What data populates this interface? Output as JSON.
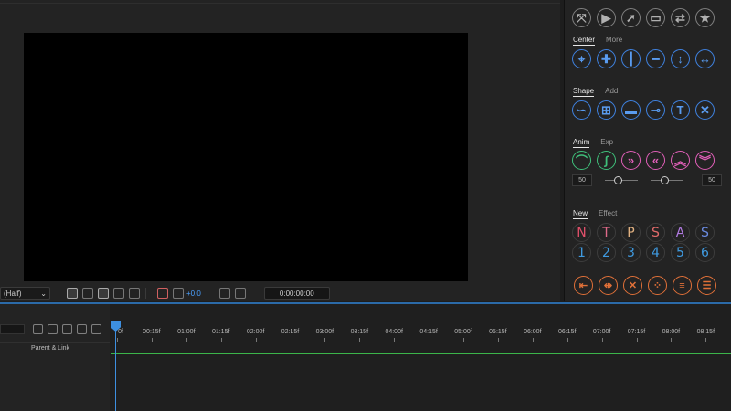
{
  "viewer": {
    "resolution": "(Half)",
    "exposure": "+0,0",
    "timecode": "0:00:00:00"
  },
  "panel": {
    "top_icons": [
      "expand-icon",
      "video-icon",
      "rocket-icon",
      "folder-icon",
      "swap-icon",
      "star-icon"
    ],
    "center_tabs": [
      "Center",
      "More"
    ],
    "center_icons": [
      "crosshair-icon",
      "center-dot-icon",
      "vertical-center-icon",
      "horizontal-center-icon",
      "vertical-stretch-icon",
      "horizontal-stretch-icon"
    ],
    "shape_tabs": [
      "Shape",
      "Add"
    ],
    "shape_icons": [
      "loop-icon",
      "add-shape-icon",
      "rounded-rect-icon",
      "path-line-icon",
      "text-t-icon",
      "compress-icon"
    ],
    "anim_tabs": [
      "Anim",
      "Exp"
    ],
    "anim_icons": [
      "ease-in-icon",
      "ease-s-icon",
      "chevron-right-icon",
      "chevron-left-icon",
      "chevron-up-icon",
      "chevron-down-icon"
    ],
    "slider_left_value": "50",
    "slider_right_value": "50",
    "new_tabs": [
      "New",
      "Effect"
    ],
    "new_letters": [
      "N",
      "T",
      "P",
      "S",
      "A",
      "S"
    ],
    "new_numbers": [
      "1",
      "2",
      "3",
      "4",
      "5",
      "6"
    ],
    "bottom_icons": [
      "align-left-icon",
      "split-icon",
      "close-icon",
      "grid-dots-icon",
      "sort-icon",
      "stack-icon"
    ],
    "letter_colors": [
      "#e0506a",
      "#e06a8a",
      "#e0b080",
      "#e06a6a",
      "#b07ae0",
      "#6a8ae0"
    ]
  },
  "timeline": {
    "column_header": "Parent & Link",
    "ticks": [
      "0f",
      "00:15f",
      "01:00f",
      "01:15f",
      "02:00f",
      "02:15f",
      "03:00f",
      "03:15f",
      "04:00f",
      "04:15f",
      "05:00f",
      "05:15f",
      "06:00f",
      "06:15f",
      "07:00f",
      "07:15f",
      "08:00f",
      "08:15f"
    ]
  }
}
